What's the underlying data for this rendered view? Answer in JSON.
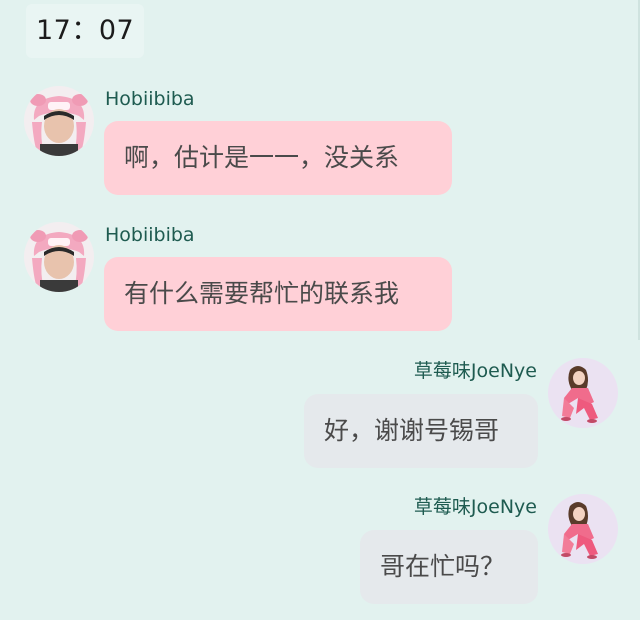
{
  "header": {
    "time": "17：07"
  },
  "messages": [
    {
      "sender": "Hobiibiba",
      "text": "啊，估计是一一，没关系",
      "avatar_icon": "pink-pig-hat-boy-avatar"
    },
    {
      "sender": "Hobiibiba",
      "text": "有什么需要帮忙的联系我",
      "avatar_icon": "pink-pig-hat-boy-avatar"
    },
    {
      "sender": "草莓味JoeNye",
      "text": "好，谢谢号锡哥",
      "avatar_icon": "girl-in-pink-illustration-avatar"
    },
    {
      "sender": "草莓味JoeNye",
      "text": "哥在忙吗？",
      "avatar_icon": "girl-in-pink-illustration-avatar"
    }
  ],
  "colors": {
    "background": "#e2f2ef",
    "incoming_bubble": "#ffd0d7",
    "outgoing_bubble": "#e5e9ec",
    "sender_name": "#1e5b50"
  }
}
